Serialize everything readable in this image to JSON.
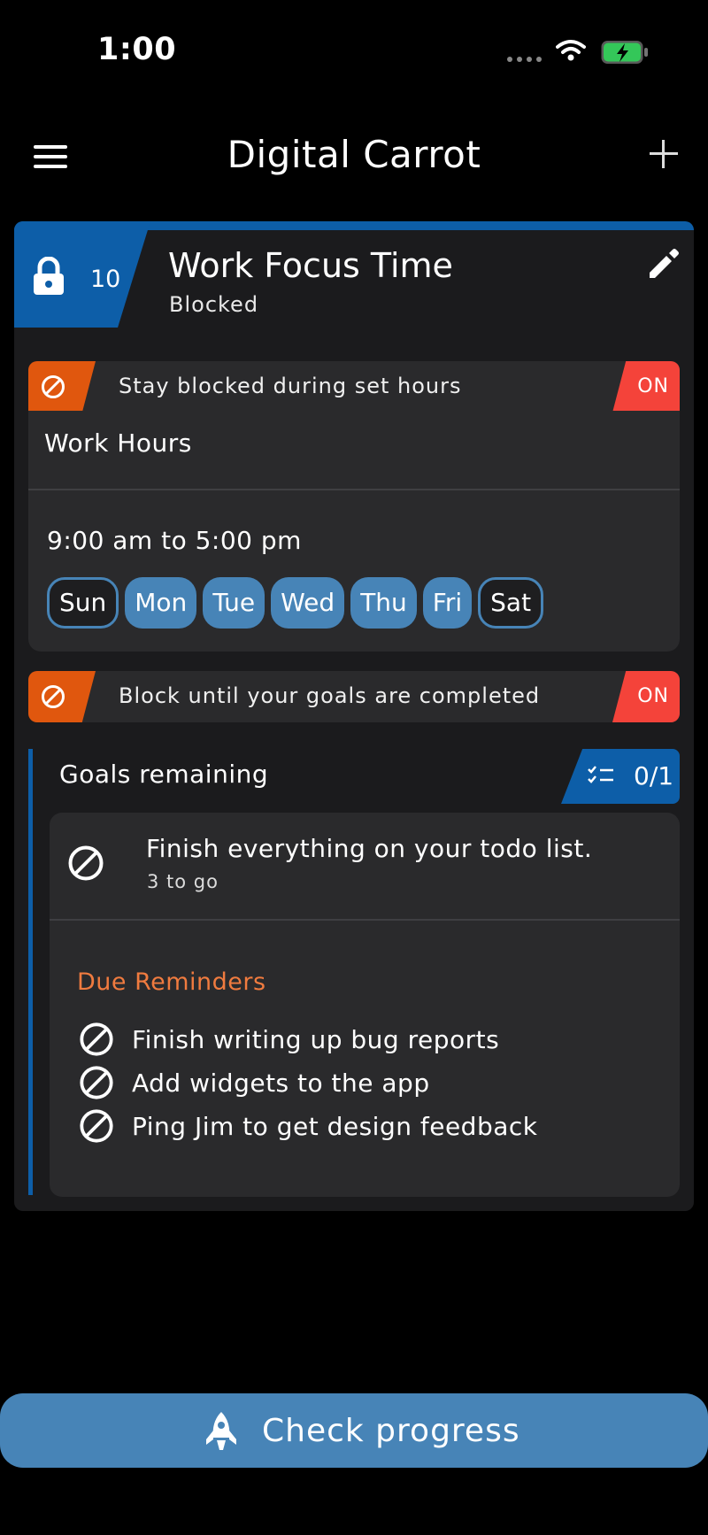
{
  "status_bar": {
    "time": "1:00"
  },
  "header": {
    "title": "Digital Carrot"
  },
  "block": {
    "lock_count": "10",
    "title": "Work Focus Time",
    "status": "Blocked",
    "rules": [
      {
        "text": "Stay blocked during set hours",
        "state": "ON"
      },
      {
        "text": "Block until your goals are completed",
        "state": "ON"
      }
    ],
    "schedule": {
      "name": "Work Hours",
      "time_range": "9:00 am to 5:00 pm",
      "days": [
        {
          "label": "Sun",
          "active": false
        },
        {
          "label": "Mon",
          "active": true
        },
        {
          "label": "Tue",
          "active": true
        },
        {
          "label": "Wed",
          "active": true
        },
        {
          "label": "Thu",
          "active": true
        },
        {
          "label": "Fri",
          "active": true
        },
        {
          "label": "Sat",
          "active": false
        }
      ]
    },
    "goals": {
      "label": "Goals remaining",
      "count": "0/1",
      "goal": "Finish everything on your todo list.",
      "goal_sub": "3 to go",
      "due_title": "Due Reminders",
      "reminders": [
        "Finish writing up bug reports",
        "Add widgets to the app",
        "Ping Jim to get design feedback"
      ]
    }
  },
  "cta": {
    "label": "Check progress"
  },
  "colors": {
    "accent_blue": "#0d5ea8",
    "chip_blue": "#4784b7",
    "orange": "#e0570e",
    "on_red": "#f4433a"
  }
}
